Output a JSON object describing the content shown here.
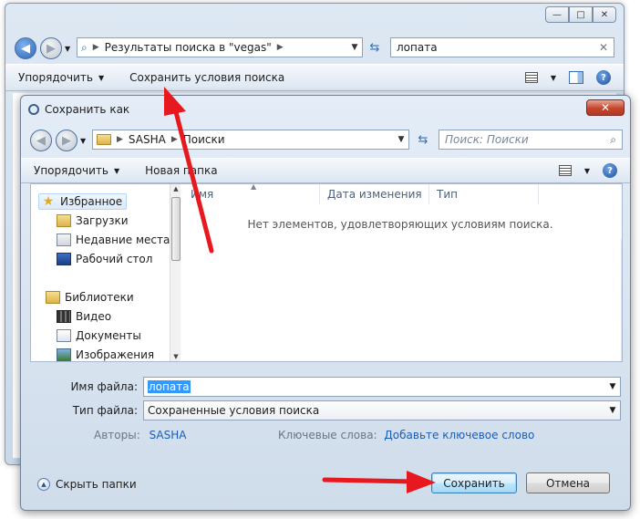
{
  "background_window": {
    "address": {
      "breadcrumb": "Результаты поиска в \"vegas\""
    },
    "search_value": "лопата",
    "toolbar": {
      "organize": "Упорядочить",
      "save_search": "Сохранить условия поиска"
    },
    "window_buttons": {
      "minimize": "—",
      "maximize": "□",
      "close": "✕"
    }
  },
  "dialog": {
    "title": "Сохранить как",
    "close_label": "✕",
    "address": {
      "root": "SASHA",
      "folder": "Поиски"
    },
    "search_placeholder": "Поиск: Поиски",
    "toolbar": {
      "organize": "Упорядочить",
      "new_folder": "Новая папка"
    },
    "nav": {
      "favorites": "Избранное",
      "downloads": "Загрузки",
      "recent": "Недавние места",
      "desktop": "Рабочий стол",
      "libraries": "Библиотеки",
      "video": "Видео",
      "documents": "Документы",
      "images": "Изображения"
    },
    "columns": {
      "name": "Имя",
      "date": "Дата изменения",
      "type": "Тип"
    },
    "empty_message": "Нет элементов, удовлетворяющих условиям поиска.",
    "filename_label": "Имя файла:",
    "filename_value": "лопата",
    "filetype_label": "Тип файла:",
    "filetype_value": "Сохраненные условия поиска",
    "authors_label": "Авторы:",
    "authors_value": "SASHA",
    "keywords_label": "Ключевые слова:",
    "keywords_link": "Добавьте ключевое слово",
    "hide_folders": "Скрыть папки",
    "save_button": "Сохранить",
    "cancel_button": "Отмена"
  },
  "colors": {
    "arrow": "#e8181f",
    "accent": "#3399ff",
    "link": "#1c5db6"
  }
}
